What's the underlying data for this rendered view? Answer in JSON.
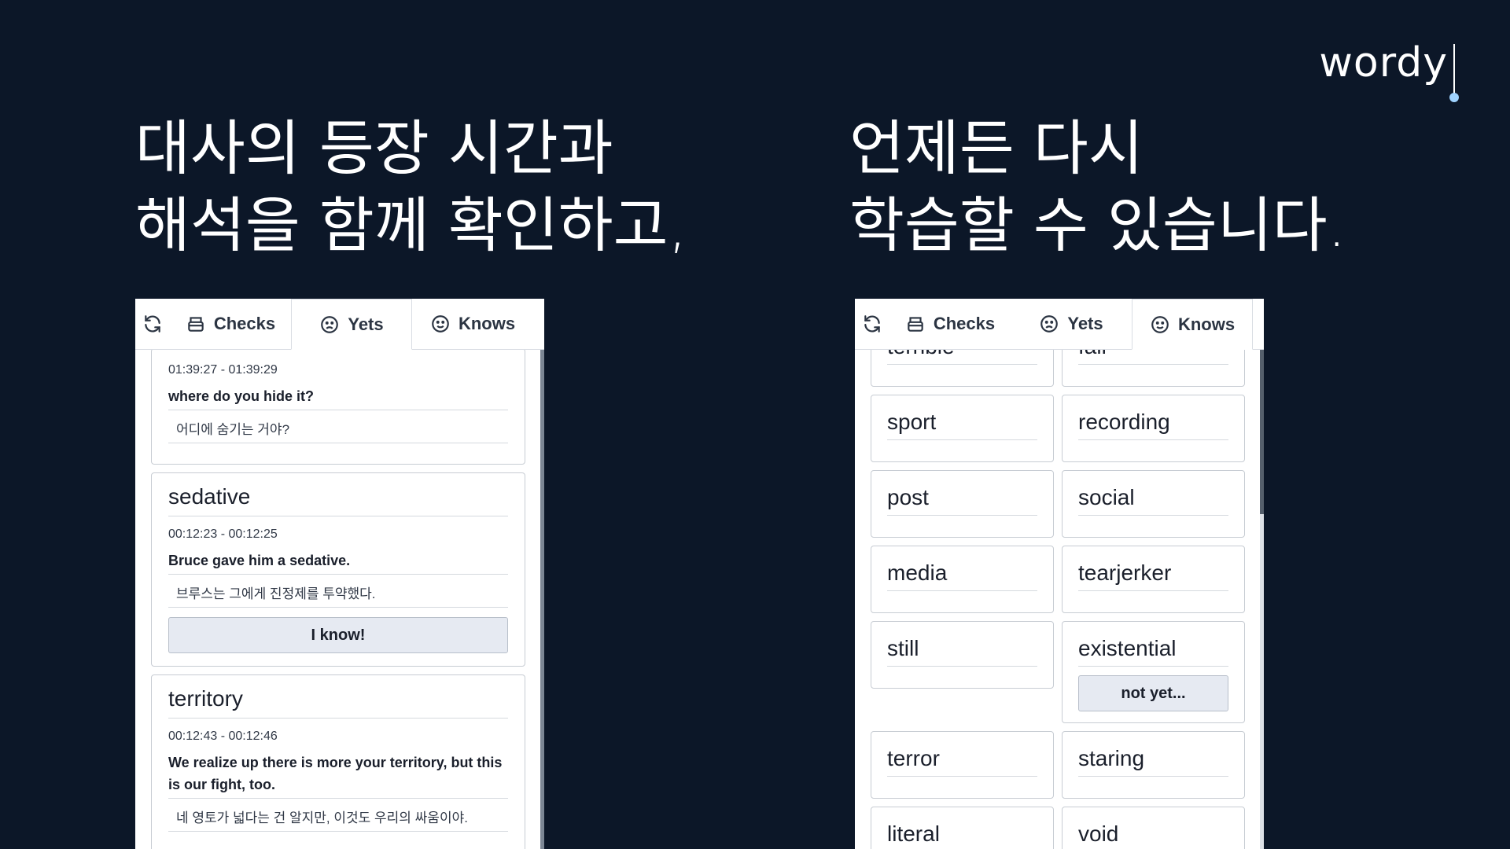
{
  "brand": {
    "logo": "wordy"
  },
  "headlines": {
    "left": "대사의 등장 시간과\n해석을 함께 확인하고,",
    "right": "언제든 다시\n학습할 수 있습니다."
  },
  "tabs": {
    "refresh_icon": "refresh-icon",
    "checks": "Checks",
    "yets": "Yets",
    "knows": "Knows"
  },
  "left_panel": {
    "active_tab": "Yets",
    "cards": [
      {
        "word": "",
        "time": "01:39:27 - 01:39:29",
        "sentence": "where do you hide it?",
        "translation": "어디에 숨기는 거야?"
      },
      {
        "word": "sedative",
        "time": "00:12:23 - 00:12:25",
        "sentence": "Bruce gave him a sedative.",
        "translation": "브루스는 그에게 진정제를 투약했다.",
        "button": "I know!"
      },
      {
        "word": "territory",
        "time": "00:12:43 - 00:12:46",
        "sentence": "We realize up there is more your territory, but this is our fight, too.",
        "translation": "네 영토가 넓다는 건 알지만, 이것도 우리의 싸움이야."
      }
    ]
  },
  "right_panel": {
    "active_tab": "Knows",
    "words": [
      [
        "terrible",
        "fall"
      ],
      [
        "sport",
        "recording"
      ],
      [
        "post",
        "social"
      ],
      [
        "media",
        "tearjerker"
      ],
      [
        "still",
        "existential"
      ],
      [
        "terror",
        "staring"
      ],
      [
        "literal",
        "void"
      ]
    ],
    "button": "not yet..."
  }
}
